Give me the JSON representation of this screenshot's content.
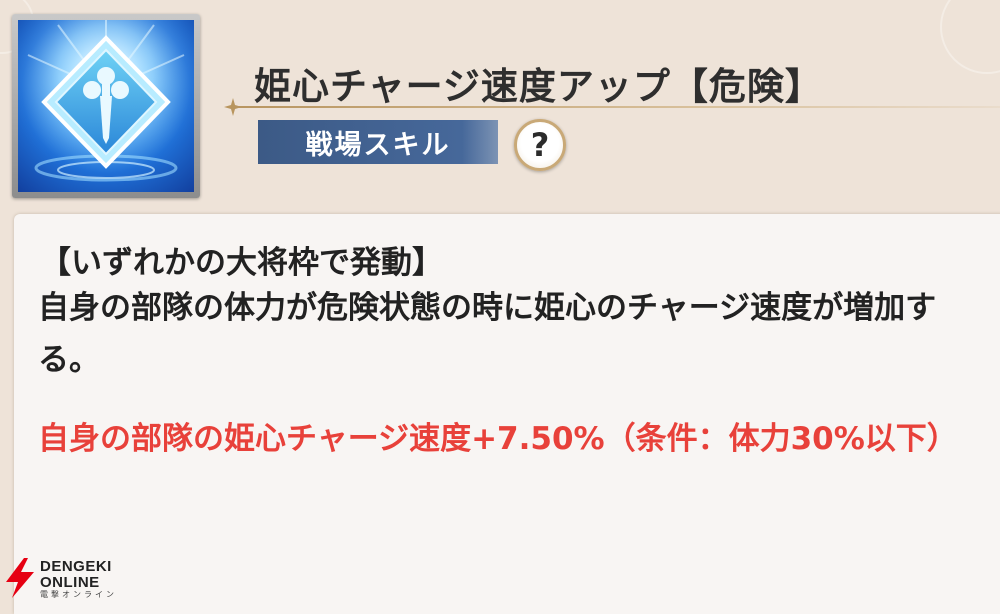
{
  "skill": {
    "title": "姫心チャージ速度アップ【危険】",
    "category": "戦場スキル",
    "help_label": "?",
    "icon": "sword-emblem-icon"
  },
  "description": {
    "condition": "【いずれかの大将枠で発動】",
    "body": "自身の部隊の体力が危険状態の時に姫心のチャージ速度が増加する。",
    "effect": "自身の部隊の姫心チャージ速度+7.50%（条件：体力30%以下）"
  },
  "watermark": {
    "line1": "DENGEKI",
    "line2": "ONLINE",
    "line3": "電撃オンライン"
  },
  "colors": {
    "badge": "#46689a",
    "effect_text": "#e8413a",
    "background": "#eee3d8",
    "panel": "#f8f5f3",
    "watermark_accent": "#e60012"
  }
}
